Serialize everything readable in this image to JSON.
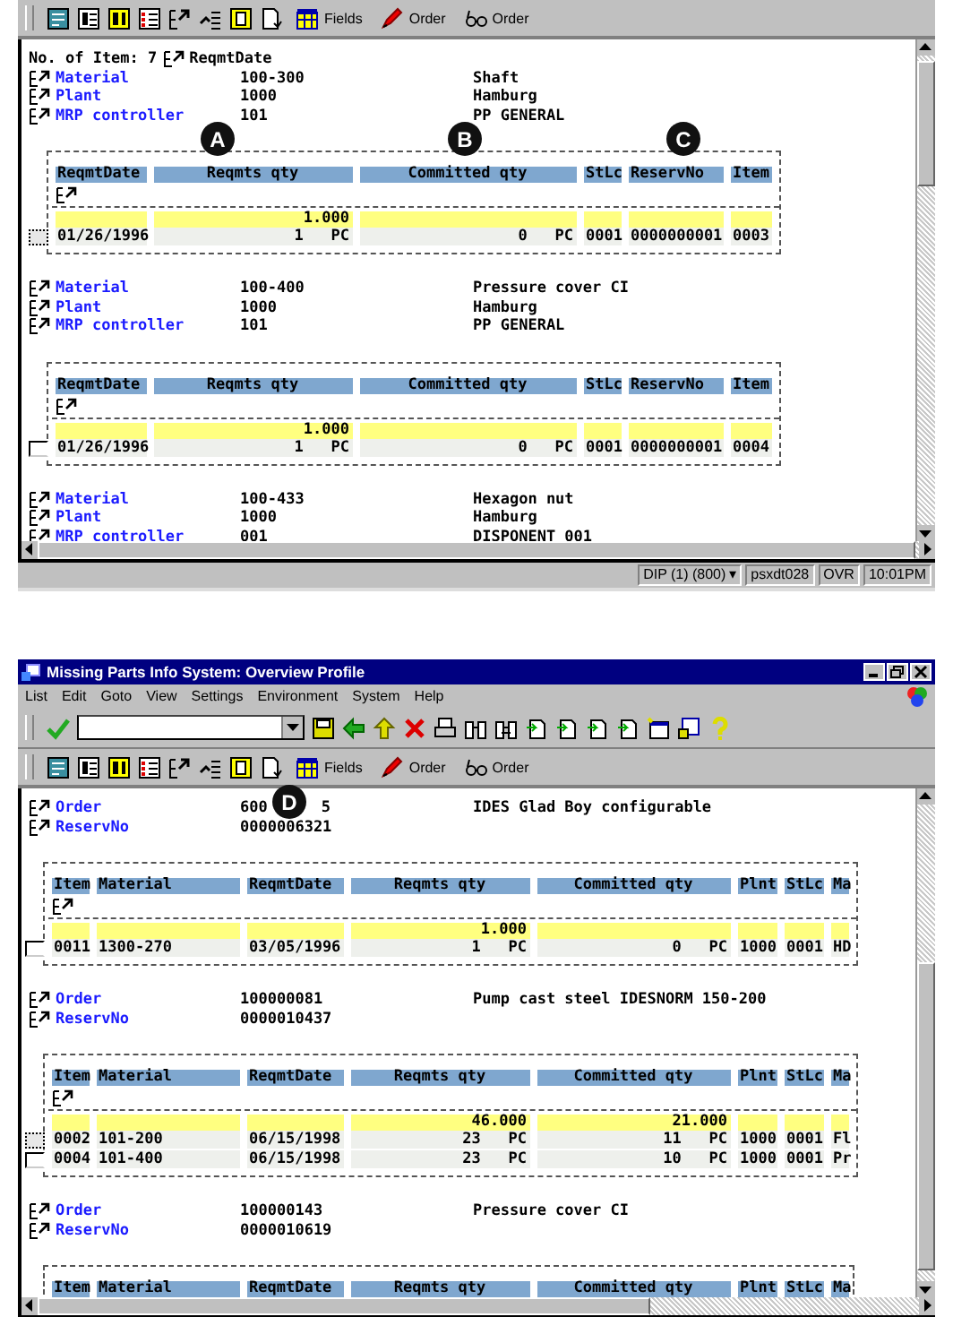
{
  "top_window": {
    "app_toolbar": [
      {
        "kind": "edit"
      },
      {
        "kind": "list"
      },
      {
        "kind": "columns"
      },
      {
        "kind": "redlist"
      },
      {
        "kind": "drill"
      },
      {
        "kind": "sort"
      },
      {
        "kind": "yellowdoc"
      },
      {
        "kind": "doc"
      },
      {
        "kind": "fields",
        "label": "Fields"
      },
      {
        "kind": "pencil",
        "label": "Order"
      },
      {
        "kind": "glasses",
        "label": "Order"
      }
    ],
    "header": {
      "label": "No. of Item: 7",
      "field": "ReqmtDate"
    },
    "groups": [
      {
        "fields": [
          {
            "label": "Material",
            "value": "100-300",
            "text": "Shaft"
          },
          {
            "label": "Plant",
            "value": "1000",
            "text": "Hamburg"
          },
          {
            "label": "MRP controller",
            "value": "101",
            "text": "PP GENERAL"
          }
        ],
        "table": {
          "kind": "material",
          "columns": [
            {
              "label": "ReqmtDate",
              "kind": "text"
            },
            {
              "label": "Reqmts qty",
              "kind": "quantity",
              "total": "1.000"
            },
            {
              "label": "Committed qty",
              "kind": "quantity"
            },
            {
              "label": "StLc",
              "kind": "text"
            },
            {
              "label": "ReservNo",
              "kind": "text"
            },
            {
              "label": "Item",
              "kind": "text"
            }
          ],
          "rows": [
            {
              "focused": true,
              "cells": [
                "01/26/1996",
                "1   PC",
                "0   PC",
                "0001",
                "0000000001",
                "0003"
              ]
            }
          ]
        }
      },
      {
        "fields": [
          {
            "label": "Material",
            "value": "100-400",
            "text": "Pressure cover CI"
          },
          {
            "label": "Plant",
            "value": "1000",
            "text": "Hamburg"
          },
          {
            "label": "MRP controller",
            "value": "101",
            "text": "PP GENERAL"
          }
        ],
        "table": {
          "kind": "material",
          "columns": [
            {
              "label": "ReqmtDate",
              "kind": "text"
            },
            {
              "label": "Reqmts qty",
              "kind": "quantity",
              "total": "1.000"
            },
            {
              "label": "Committed qty",
              "kind": "quantity"
            },
            {
              "label": "StLc",
              "kind": "text"
            },
            {
              "label": "ReservNo",
              "kind": "text"
            },
            {
              "label": "Item",
              "kind": "text"
            }
          ],
          "rows": [
            {
              "focused": false,
              "cells": [
                "01/26/1996",
                "1   PC",
                "0   PC",
                "0001",
                "0000000001",
                "0004"
              ]
            }
          ]
        }
      },
      {
        "fields": [
          {
            "label": "Material",
            "value": "100-433",
            "text": "Hexagon nut"
          },
          {
            "label": "Plant",
            "value": "1000",
            "text": "Hamburg"
          },
          {
            "label": "MRP controller",
            "value": "001",
            "text": "DISPONENT 001"
          }
        ]
      }
    ],
    "status_bar": [
      {
        "text": "DIP (1) (800)",
        "dropdown": "▾"
      },
      {
        "text": "psxdt028"
      },
      {
        "text": "OVR"
      },
      {
        "text": "10:01PM"
      }
    ]
  },
  "bottom_window": {
    "title": "Missing Parts Info System: Overview Profile",
    "menu": [
      "List",
      "Edit",
      "Goto",
      "View",
      "Settings",
      "Environment",
      "System",
      "Help"
    ],
    "toolbar": [
      {
        "kind": "check"
      },
      {
        "kind": "command-field"
      },
      {
        "kind": "save"
      },
      {
        "kind": "back"
      },
      {
        "kind": "up"
      },
      {
        "kind": "cancel"
      },
      {
        "kind": "print"
      },
      {
        "kind": "find"
      },
      {
        "kind": "findnext"
      },
      {
        "kind": "page"
      },
      {
        "kind": "page"
      },
      {
        "kind": "page"
      },
      {
        "kind": "page"
      },
      {
        "kind": "newsession"
      },
      {
        "kind": "shortcut"
      },
      {
        "kind": "help"
      }
    ],
    "app_toolbar": [
      {
        "kind": "edit"
      },
      {
        "kind": "list"
      },
      {
        "kind": "columns"
      },
      {
        "kind": "redlist"
      },
      {
        "kind": "drill"
      },
      {
        "kind": "sort"
      },
      {
        "kind": "yellowdoc"
      },
      {
        "kind": "doc"
      },
      {
        "kind": "fields",
        "label": "Fields"
      },
      {
        "kind": "pencil",
        "label": "Order"
      },
      {
        "kind": "glasses",
        "label": "Order"
      }
    ],
    "groups": [
      {
        "fields": [
          {
            "label": "Order",
            "value": "600",
            "value_end": "5",
            "text": "IDES Glad Boy configurable"
          },
          {
            "label": "ReservNo",
            "value": "0000006321"
          }
        ],
        "table": {
          "kind": "order",
          "columns": [
            {
              "label": "Item",
              "kind": "text"
            },
            {
              "label": "Material",
              "kind": "text"
            },
            {
              "label": "ReqmtDate",
              "kind": "text"
            },
            {
              "label": "Reqmts qty",
              "kind": "quantity",
              "total": "1.000"
            },
            {
              "label": "Committed qty",
              "kind": "quantity"
            },
            {
              "label": "Plnt",
              "kind": "text"
            },
            {
              "label": "StLc",
              "kind": "text"
            },
            {
              "label": "Ma",
              "kind": "text"
            }
          ],
          "rows": [
            {
              "focused": false,
              "cells": [
                "0011",
                "1300-270",
                "03/05/1996",
                "1   PC",
                "0   PC",
                "1000",
                "0001",
                "HD"
              ]
            }
          ]
        }
      },
      {
        "fields": [
          {
            "label": "Order",
            "value": "100000081",
            "text": "Pump cast steel IDESNORM 150-200"
          },
          {
            "label": "ReservNo",
            "value": "0000010437"
          }
        ],
        "table": {
          "kind": "order",
          "columns": [
            {
              "label": "Item",
              "kind": "text"
            },
            {
              "label": "Material",
              "kind": "text"
            },
            {
              "label": "ReqmtDate",
              "kind": "text"
            },
            {
              "label": "Reqmts qty",
              "kind": "quantity",
              "total": "46.000"
            },
            {
              "label": "Committed qty",
              "kind": "quantity",
              "total": "21.000"
            },
            {
              "label": "Plnt",
              "kind": "text"
            },
            {
              "label": "StLc",
              "kind": "text"
            },
            {
              "label": "Ma",
              "kind": "text"
            }
          ],
          "rows": [
            {
              "focused": true,
              "cells": [
                "0002",
                "101-200",
                "06/15/1998",
                "23   PC",
                "11   PC",
                "1000",
                "0001",
                "Fl"
              ]
            },
            {
              "focused": false,
              "cells": [
                "0004",
                "101-400",
                "06/15/1998",
                "23   PC",
                "10   PC",
                "1000",
                "0001",
                "Pr"
              ]
            }
          ]
        }
      },
      {
        "fields": [
          {
            "label": "Order",
            "value": "100000143",
            "text": "Pressure cover CI"
          },
          {
            "label": "ReservNo",
            "value": "0000010619"
          }
        ],
        "table": {
          "kind": "order",
          "columns": [
            {
              "label": "Item",
              "kind": "text"
            },
            {
              "label": "Material",
              "kind": "text"
            },
            {
              "label": "ReqmtDate",
              "kind": "text"
            },
            {
              "label": "Reqmts qty",
              "kind": "quantity"
            },
            {
              "label": "Committed qty",
              "kind": "quantity"
            },
            {
              "label": "Plnt",
              "kind": "text"
            },
            {
              "label": "StLc",
              "kind": "text"
            },
            {
              "label": "Ma",
              "kind": "text"
            }
          ]
        }
      }
    ]
  },
  "callouts": [
    "A",
    "B",
    "C",
    "D"
  ]
}
